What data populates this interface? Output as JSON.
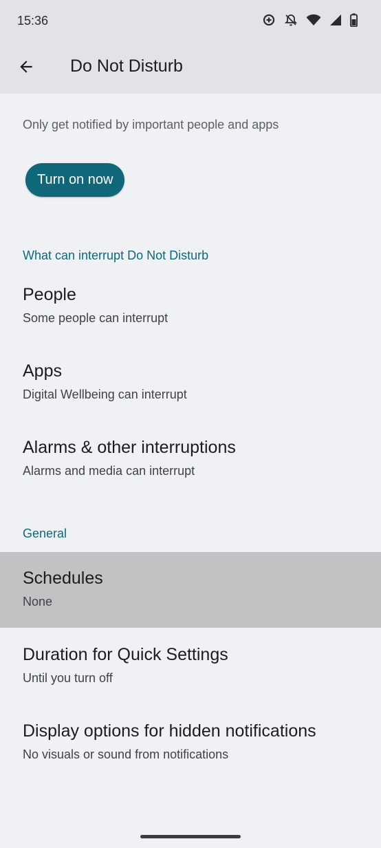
{
  "status_bar": {
    "time": "15:36",
    "icons": [
      "data-saver-icon",
      "alarm-off-icon",
      "wifi-icon",
      "signal-icon",
      "battery-icon"
    ]
  },
  "app_bar": {
    "back_icon": "arrow-back-icon",
    "title": "Do Not Disturb"
  },
  "description": "Only get notified by important people and apps",
  "turn_on_button": "Turn on now",
  "section_interrupt": {
    "header": "What can interrupt Do Not Disturb",
    "items": [
      {
        "title": "People",
        "subtitle": "Some people can interrupt"
      },
      {
        "title": "Apps",
        "subtitle": "Digital Wellbeing can interrupt"
      },
      {
        "title": "Alarms & other interruptions",
        "subtitle": "Alarms and media can interrupt"
      }
    ]
  },
  "section_general": {
    "header": "General",
    "items": [
      {
        "title": "Schedules",
        "subtitle": "None"
      },
      {
        "title": "Duration for Quick Settings",
        "subtitle": "Until you turn off"
      },
      {
        "title": "Display options for hidden notifications",
        "subtitle": "No visuals or sound from notifications"
      }
    ]
  },
  "colors": {
    "accent": "#0f6779",
    "background": "#eff1f4",
    "appbar": "#e1e3e6",
    "selected_row": "#c1c2c4"
  }
}
